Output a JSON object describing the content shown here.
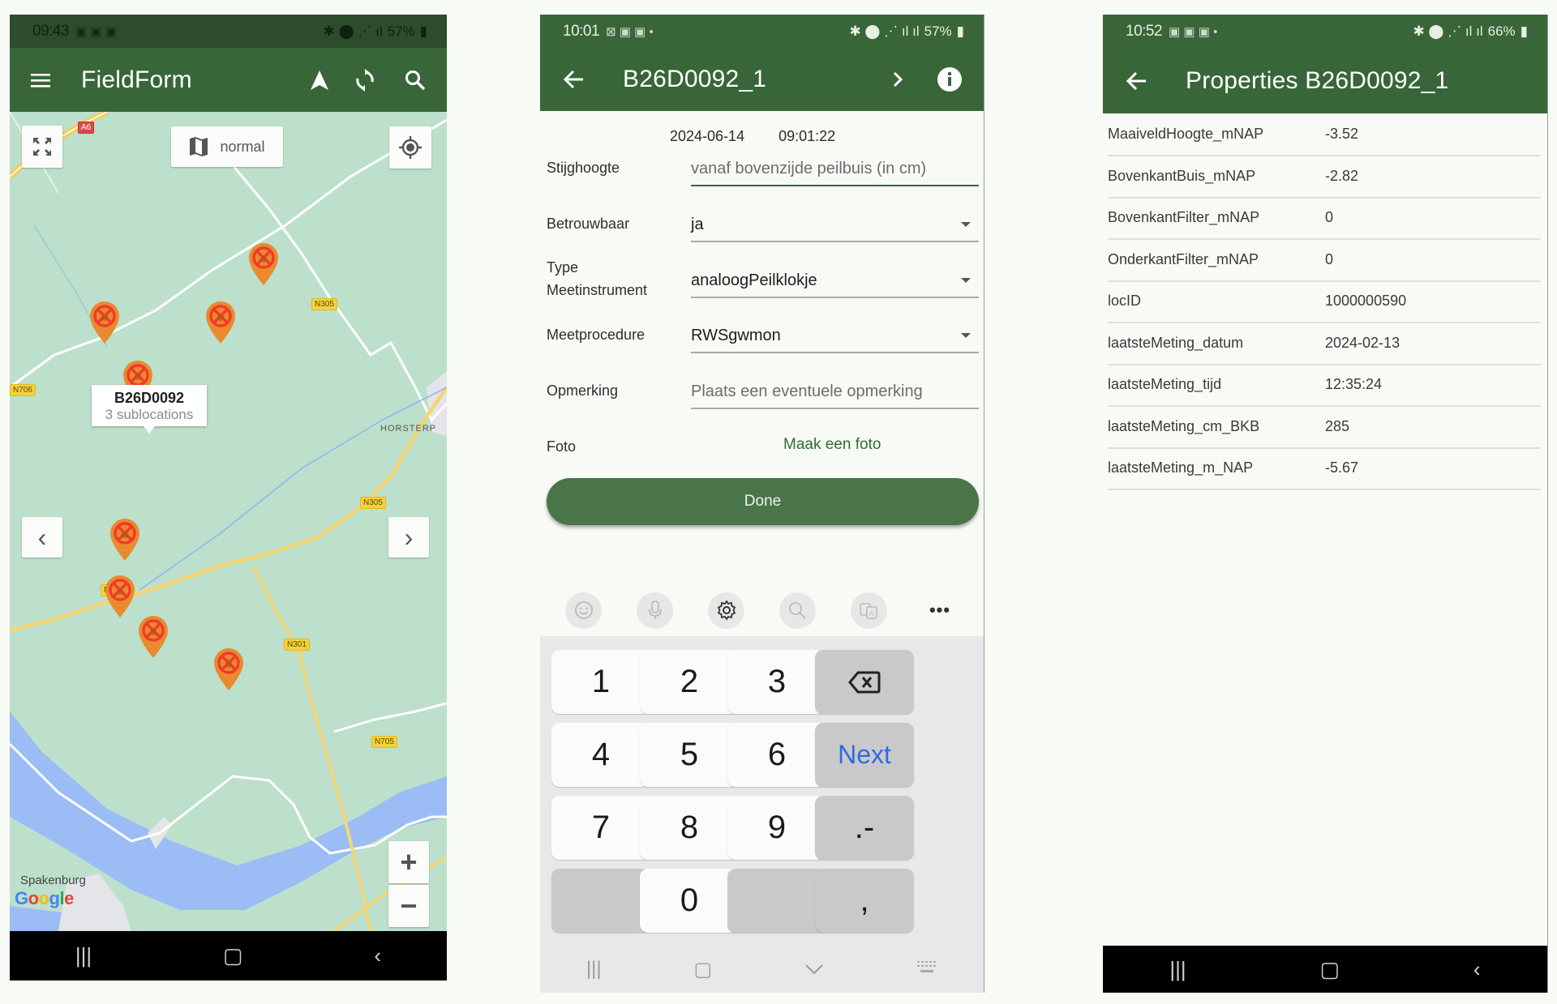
{
  "map_screen": {
    "status": {
      "time": "09:43",
      "notification_icons": "▣ ▣ ▣",
      "system_icons": "✱ ⬤ ⋰ ıl",
      "battery": "57%"
    },
    "app_title": "FieldForm",
    "icons": {
      "menu": "≡",
      "navigate": "▲",
      "sync": "⟳",
      "search": "⌕"
    },
    "map_type_label": "normal",
    "info_window": {
      "title": "B26D0092",
      "subtitle": "3 sublocations"
    },
    "road_labels": [
      "A6",
      "N305",
      "N706",
      "N305",
      "N305",
      "N301",
      "N705"
    ],
    "place_labels": [
      "HORSTERP",
      "Spakenburg"
    ],
    "attribution": "Google",
    "controls": {
      "prev": "‹",
      "next": "›",
      "zoom_in": "+",
      "zoom_out": "−"
    },
    "marker_count": 9
  },
  "form_screen": {
    "status": {
      "time": "10:01",
      "notification_icons": "⊠ ▣ ▣ •",
      "system_icons": "✱ ⬤ ⋰ ıl ıl",
      "battery": "57%"
    },
    "title": "B26D0092_1",
    "date": "2024-06-14",
    "time": "09:01:22",
    "fields": [
      {
        "label": "Stijghoogte",
        "value": "",
        "placeholder": "vanaf bovenzijde peilbuis (in cm)",
        "type": "input"
      },
      {
        "label": "Betrouwbaar",
        "value": "ja",
        "type": "select"
      },
      {
        "label": "Type Meetinstrument",
        "value": "analoogPeilklokje",
        "type": "select"
      },
      {
        "label": "Meetprocedure",
        "value": "RWSgwmon",
        "type": "select"
      },
      {
        "label": "Opmerking",
        "value": "",
        "placeholder": "Plaats een eventuele opmerking",
        "type": "input"
      },
      {
        "label": "Foto",
        "link": "Maak een foto",
        "type": "link"
      }
    ],
    "done_label": "Done",
    "keyboard": {
      "toolbar": [
        "emoji",
        "microphone",
        "settings",
        "search",
        "translate",
        "more"
      ],
      "keys": [
        [
          "1",
          "2",
          "3",
          "⌫"
        ],
        [
          "4",
          "5",
          "6",
          "Next"
        ],
        [
          "7",
          "8",
          "9",
          ".-"
        ],
        [
          "",
          "0",
          "",
          ","
        ]
      ]
    }
  },
  "properties_screen": {
    "status": {
      "time": "10:52",
      "notification_icons": "▣ ▣ ▣ •",
      "system_icons": "✱ ⬤ ⋰ ıl ıl",
      "battery": "66%"
    },
    "title": "Properties B26D0092_1",
    "rows": [
      {
        "key": "MaaiveldHoogte_mNAP",
        "value": "-3.52"
      },
      {
        "key": "BovenkantBuis_mNAP",
        "value": "-2.82"
      },
      {
        "key": "BovenkantFilter_mNAP",
        "value": "0"
      },
      {
        "key": "OnderkantFilter_mNAP",
        "value": "0"
      },
      {
        "key": "locID",
        "value": "1000000590"
      },
      {
        "key": "laatsteMeting_datum",
        "value": "2024-02-13"
      },
      {
        "key": "laatsteMeting_tijd",
        "value": "12:35:24"
      },
      {
        "key": "laatsteMeting_cm_BKB",
        "value": "285"
      },
      {
        "key": "laatsteMeting_m_NAP",
        "value": "-5.67"
      }
    ]
  },
  "navbar": {
    "recents": "|||",
    "home": "▢",
    "back": "‹",
    "hide_keyboard": "⌄",
    "keyboard_switch": "⌨"
  },
  "colors": {
    "primary": "#386638",
    "status_dark": "#2c4c2c",
    "button": "#4a7548",
    "accent_link": "#2f6d2f",
    "map_land": "#bce0cb",
    "map_water": "#9bbcf5",
    "marker": "#e98a2e",
    "marker_cross": "#f23a2a",
    "next_key": "#2f6be0"
  }
}
